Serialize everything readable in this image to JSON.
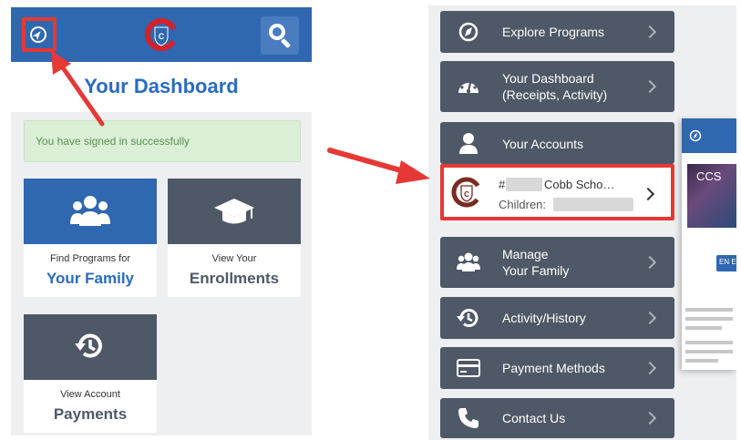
{
  "left": {
    "title": "Your Dashboard",
    "alert": "You have signed in successfully",
    "tiles": [
      {
        "sub": "Find Programs for",
        "main": "Your Family",
        "icon": "users-icon"
      },
      {
        "sub": "View Your",
        "main": "Enrollments",
        "icon": "graduation-cap-icon"
      },
      {
        "sub": "View Account",
        "main": "Payments",
        "icon": "history-icon"
      }
    ]
  },
  "right": {
    "menu": [
      {
        "label": "Explore Programs",
        "icon": "compass-icon"
      },
      {
        "label1": "Your Dashboard",
        "label2": "(Receipts, Activity)",
        "icon": "dashboard-gauge-icon"
      },
      {
        "label": "Your Accounts",
        "icon": "user-icon"
      },
      {
        "label1": "Manage",
        "label2": "Your Family",
        "icon": "users-icon"
      },
      {
        "label": "Activity/History",
        "icon": "history-icon"
      },
      {
        "label": "Payment Methods",
        "icon": "credit-card-icon"
      },
      {
        "label": "Contact Us",
        "icon": "phone-icon"
      }
    ],
    "account": {
      "number_prefix": "#",
      "name": "Cobb Scho…",
      "children_label": "Children:"
    },
    "preview": {
      "hero_text": "CCS",
      "button_text": "EN E"
    }
  },
  "colors": {
    "brand_blue": "#2f67b1",
    "menu_gray": "#4f5866",
    "highlight_red": "#e53935",
    "alert_green": "#dbeed6"
  }
}
